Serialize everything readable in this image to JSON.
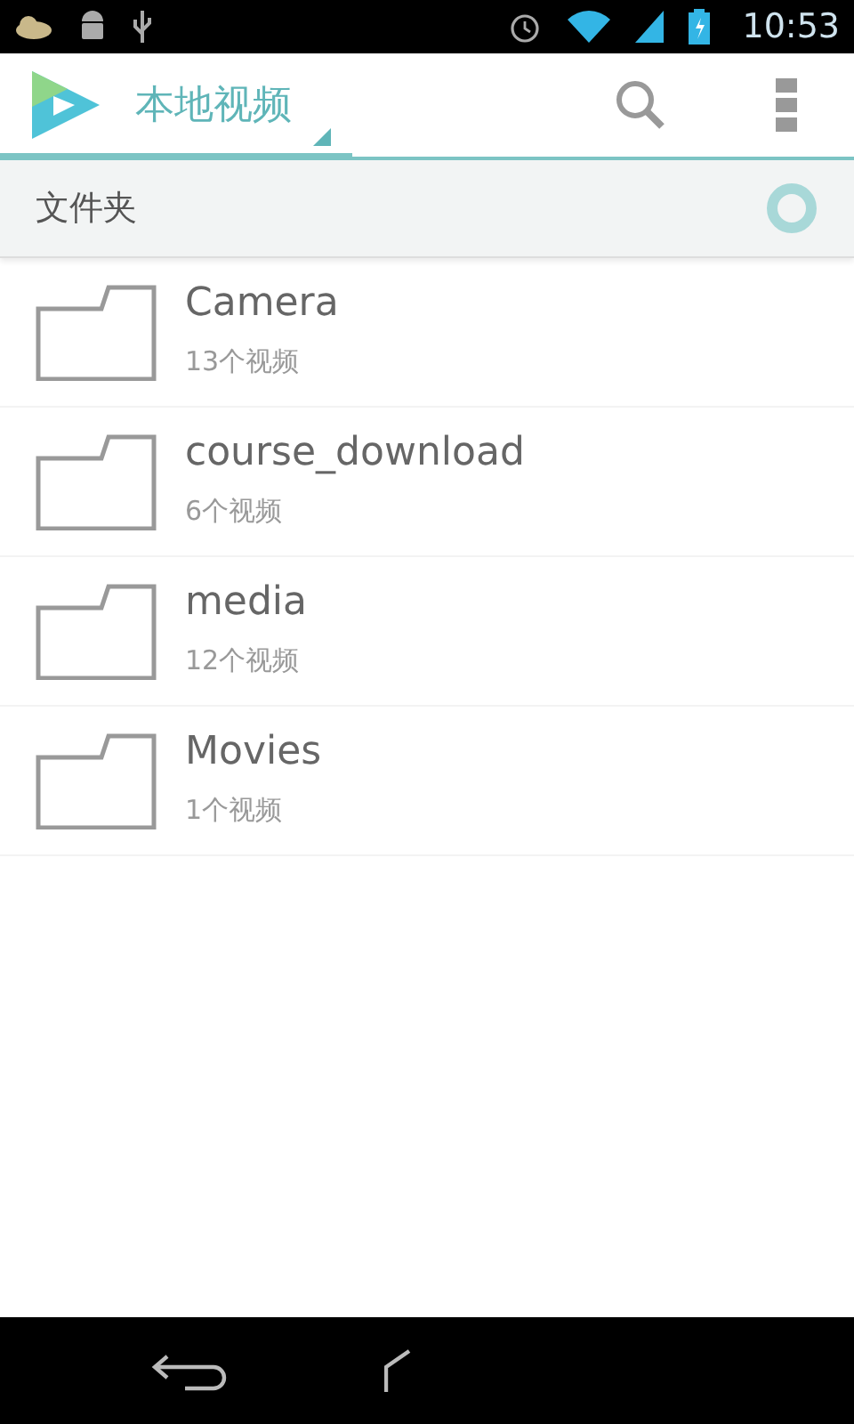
{
  "status_bar": {
    "time": "10:53"
  },
  "app_bar": {
    "title": "本地视频"
  },
  "section": {
    "title": "文件夹"
  },
  "folders": [
    {
      "name": "Camera",
      "count": "13个视频"
    },
    {
      "name": "course_download",
      "count": "6个视频"
    },
    {
      "name": "media",
      "count": "12个视频"
    },
    {
      "name": "Movies",
      "count": "1个视频"
    }
  ]
}
